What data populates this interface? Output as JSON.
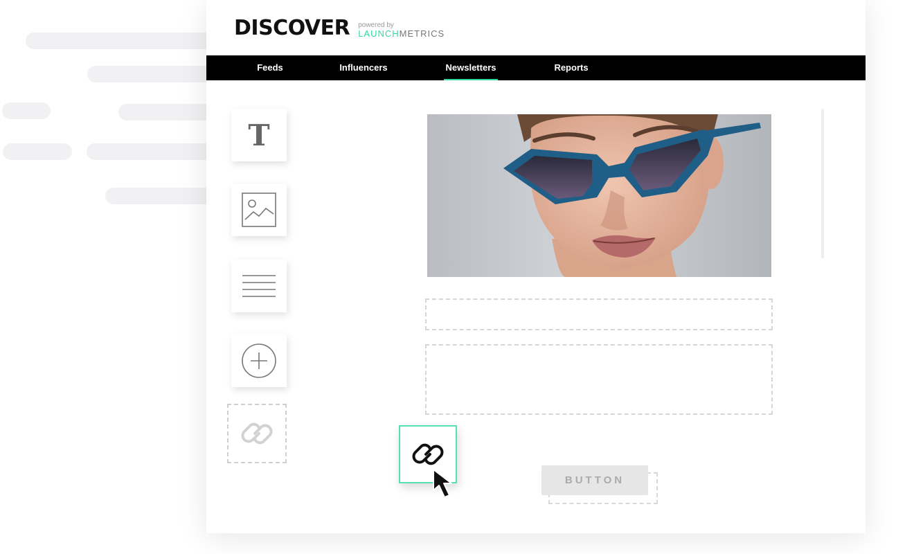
{
  "app": {
    "logo": "DISCOVER",
    "powered_by": "powered by",
    "brand_launch": "LAUNCH",
    "brand_metrics": "METRICS"
  },
  "nav": {
    "items": [
      {
        "label": "Feeds"
      },
      {
        "label": "Influencers"
      },
      {
        "label": "Newsletters",
        "active": true
      },
      {
        "label": "Reports"
      }
    ]
  },
  "tools": [
    {
      "icon": "text-icon",
      "glyph": "T"
    },
    {
      "icon": "image-icon"
    },
    {
      "icon": "paragraph-icon"
    },
    {
      "icon": "add-icon"
    },
    {
      "icon": "link-icon"
    }
  ],
  "canvas": {
    "button_label": "BUTTON"
  },
  "colors": {
    "accent": "#2fd9a6",
    "nav_bg": "#000000"
  }
}
